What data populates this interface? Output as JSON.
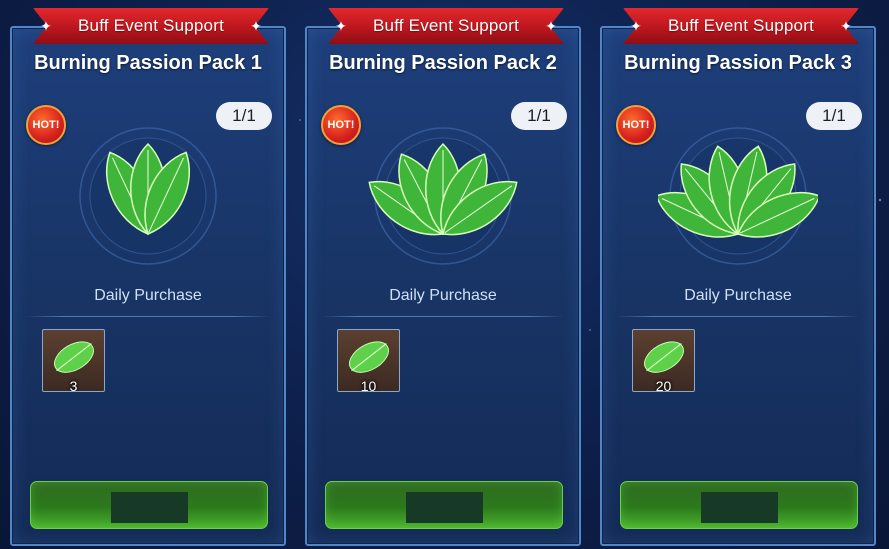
{
  "banner_label": "Buff Event Support",
  "hot_label": "HOT!",
  "daily_label": "Daily Purchase",
  "colors": {
    "ribbon": "#d81f26",
    "button": "#3a8f24",
    "card": "#1b3a72"
  },
  "packs": [
    {
      "title": "Burning Passion Pack 1",
      "limit": "1/1",
      "leaf_count_shown": 3,
      "reward": {
        "icon": "leaf-icon",
        "qty": "3"
      }
    },
    {
      "title": "Burning Passion Pack 2",
      "limit": "1/1",
      "leaf_count_shown": 5,
      "reward": {
        "icon": "leaf-icon",
        "qty": "10"
      }
    },
    {
      "title": "Burning Passion Pack 3",
      "limit": "1/1",
      "leaf_count_shown": 6,
      "reward": {
        "icon": "leaf-icon",
        "qty": "20"
      }
    }
  ]
}
